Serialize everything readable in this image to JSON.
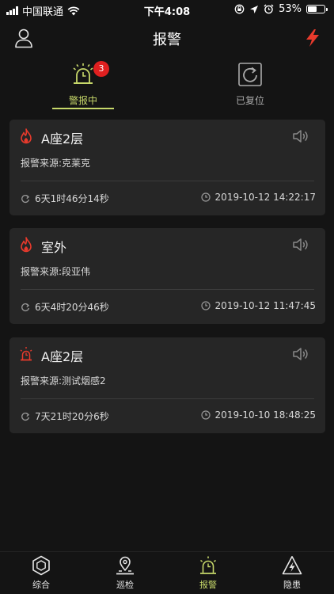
{
  "status_bar": {
    "carrier": "中国联通",
    "time": "下午4:08",
    "battery_percent": "53%",
    "battery_level": 0.53,
    "icons": [
      "signal-icon",
      "wifi-icon",
      "rotation-lock-icon",
      "location-icon",
      "alarm-clock-icon",
      "battery-icon"
    ]
  },
  "header": {
    "title": "报警",
    "left_icon": "user-icon",
    "right_icon": "lightning-icon"
  },
  "tabs": [
    {
      "label": "警报中",
      "icon": "alarm-light-icon",
      "badge": "3",
      "active": true
    },
    {
      "label": "已复位",
      "icon": "reset-icon",
      "active": false
    }
  ],
  "alarms": [
    {
      "location": "A座2层",
      "icon": "fire-icon",
      "source_label": "报警来源:",
      "source": "克莱克",
      "duration": "6天1时46分14秒",
      "timestamp": "2019-10-12 14:22:17"
    },
    {
      "location": "室外",
      "icon": "fire-icon",
      "source_label": "报警来源:",
      "source": "段亚伟",
      "duration": "6天4时20分46秒",
      "timestamp": "2019-10-12 11:47:45"
    },
    {
      "location": "A座2层",
      "icon": "alarm-light-icon",
      "source_label": "报警来源:",
      "source": "测试烟感2",
      "duration": "7天21时20分6秒",
      "timestamp": "2019-10-10 18:48:25"
    }
  ],
  "tabbar": [
    {
      "label": "综合",
      "icon": "hexagon-icon",
      "active": false
    },
    {
      "label": "巡检",
      "icon": "map-pin-icon",
      "active": false
    },
    {
      "label": "报警",
      "icon": "alarm-light-icon",
      "active": true
    },
    {
      "label": "隐患",
      "icon": "hazard-icon",
      "active": false
    }
  ],
  "colors": {
    "background": "#141414",
    "card": "#262626",
    "accent": "#c7d86a",
    "alarm_red": "#e02020"
  }
}
